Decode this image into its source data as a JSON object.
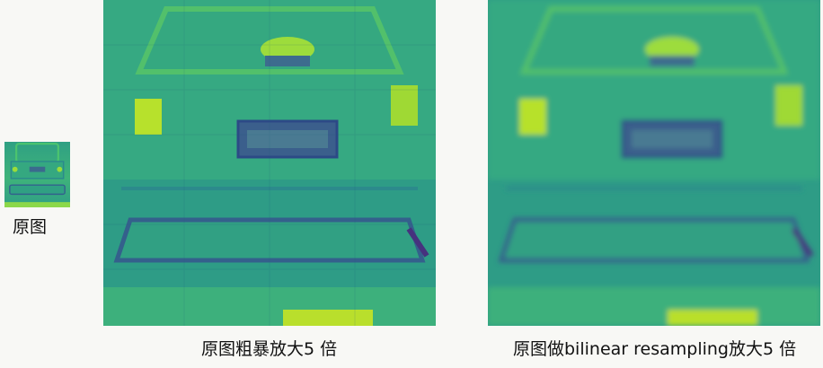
{
  "figure": {
    "panels": [
      {
        "caption": "原图",
        "description_icon": "car-rear-feature-map-small"
      },
      {
        "caption": "原图粗暴放大5 倍",
        "description_icon": "car-rear-feature-map-nearest"
      },
      {
        "caption": "原图做bilinear resampling放大5 倍",
        "description_icon": "car-rear-feature-map-bilinear"
      }
    ],
    "colors": {
      "background": "#f8f8f5",
      "base": "#2a9e86",
      "bright": "#7fd34e",
      "yellow": "#c8e020",
      "dark": "#3b528b",
      "deep": "#472d7b"
    }
  }
}
